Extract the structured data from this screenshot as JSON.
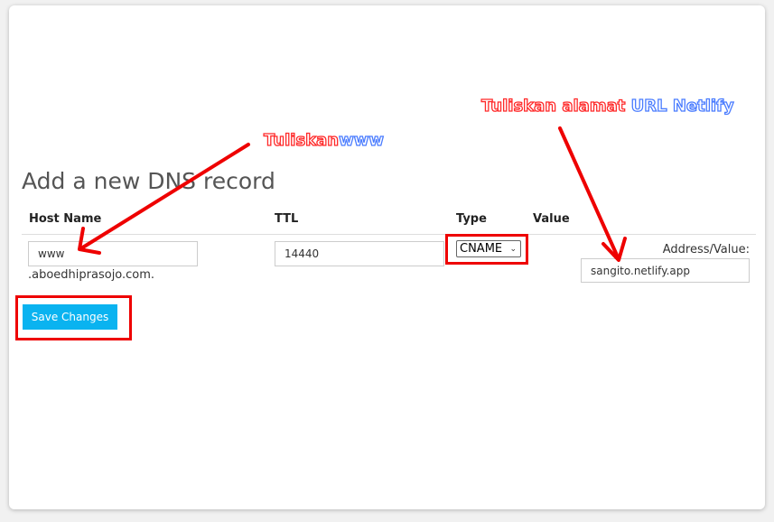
{
  "form": {
    "heading": "Add a new DNS record",
    "columns": {
      "host": "Host Name",
      "ttl": "TTL",
      "type": "Type",
      "value": "Value"
    },
    "host_value": "www",
    "domain_suffix": ".aboedhiprasojo.com.",
    "ttl_value": "14440",
    "type_selected": "CNAME",
    "value_label": "Address/Value:",
    "value_input": "sangito.netlify.app",
    "save_label": "Save Changes"
  },
  "annotations": {
    "host_note": {
      "prefix": "Tuliskan",
      "highlight": "www"
    },
    "value_note": {
      "prefix": "Tuliskan alamat",
      "highlight": "URL Netlify"
    },
    "colors": {
      "accent": "#ff0000",
      "red_text": "#ff2a2a",
      "blue_text": "#4a7cff",
      "button": "#0ab3f0"
    }
  }
}
